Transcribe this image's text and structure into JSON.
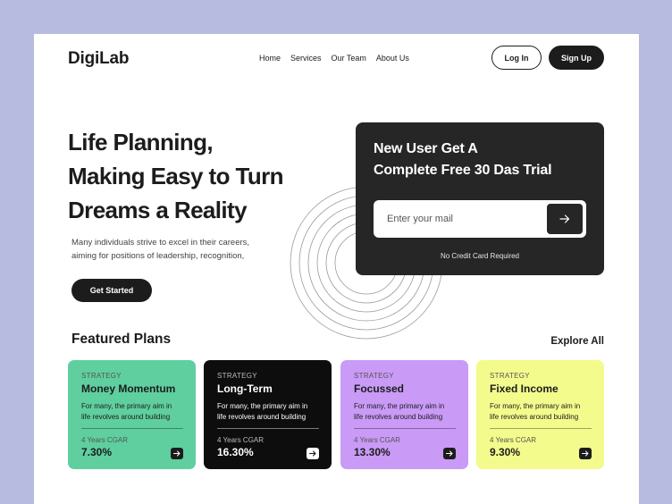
{
  "header": {
    "logo": "DigiLab",
    "nav": [
      "Home",
      "Services",
      "Our Team",
      "About Us"
    ],
    "login_label": "Log In",
    "signup_label": "Sign Up"
  },
  "hero": {
    "title_lines": [
      "Life Planning,",
      "Making Easy to Turn",
      "Dreams a Reality"
    ],
    "desc_lines": [
      "Many individuals strive to excel in their careers,",
      "aiming for positions of leadership, recognition,"
    ],
    "cta_label": "Get Started"
  },
  "trial": {
    "heading_lines": [
      "New User Get A",
      "Complete Free 30 Das Trial"
    ],
    "email_placeholder": "Enter your mail",
    "note": "No Credit Card Required"
  },
  "featured": {
    "title": "Featured Plans",
    "explore_label": "Explore All",
    "plans": [
      {
        "tag": "STRATEGY",
        "name": "Money Momentum",
        "desc_lines": [
          "For many, the primary aim in",
          "life revolves around building"
        ],
        "meta": "4 Years CGAR",
        "rate": "7.30%",
        "color": "#5fcf9f",
        "theme": "light"
      },
      {
        "tag": "STRATEGY",
        "name": "Long-Term",
        "desc_lines": [
          "For many, the primary aim in",
          "life revolves around building"
        ],
        "meta": "4 Years CGAR",
        "rate": "16.30%",
        "color": "#0d0d0d",
        "theme": "dark"
      },
      {
        "tag": "STRATEGY",
        "name": "Focussed",
        "desc_lines": [
          "For many, the primary aim in",
          "life revolves around building"
        ],
        "meta": "4 Years CGAR",
        "rate": "13.30%",
        "color": "#c99af6",
        "theme": "light"
      },
      {
        "tag": "STRATEGY",
        "name": "Fixed Income",
        "desc_lines": [
          "For many, the primary aim in",
          "life revolves around building"
        ],
        "meta": "4 Years CGAR",
        "rate": "9.30%",
        "color": "#f3fb8c",
        "theme": "light"
      }
    ]
  },
  "icons": {
    "submit": "arrow-right-icon",
    "plan_go": "arrow-right-icon"
  },
  "colors": {
    "background": "#b6bbdf",
    "surface": "#ffffff",
    "dark": "#262626"
  }
}
